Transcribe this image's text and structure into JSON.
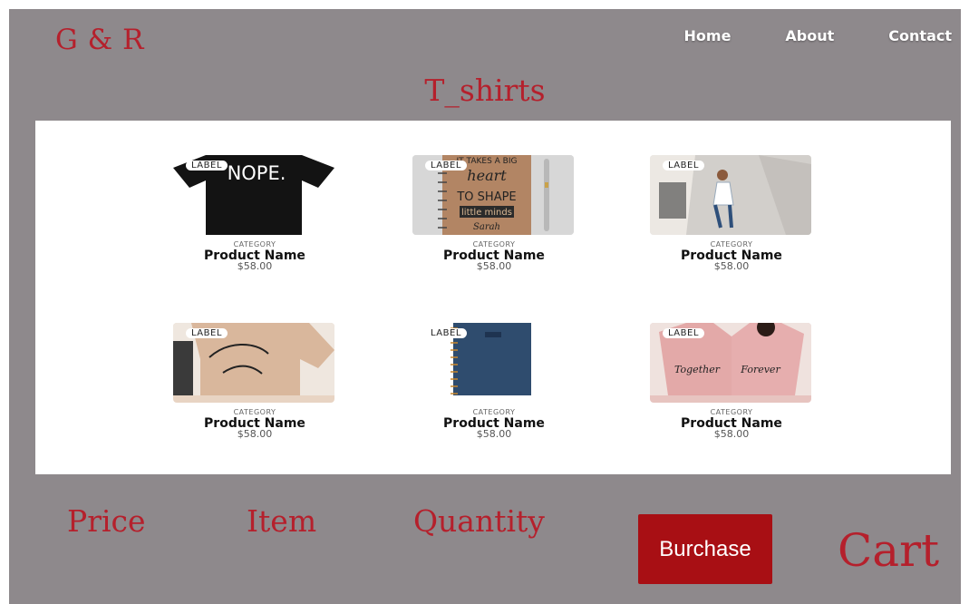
{
  "brand": "G & R",
  "nav": {
    "home": "Home",
    "about": "About",
    "contact": "Contact"
  },
  "page_title": "T_shirts",
  "products": [
    {
      "badge": "LABEL",
      "category": "CATEGORY",
      "name": "Product Name",
      "price": "$58.00",
      "image": "black t-shirt with NOPE. print"
    },
    {
      "badge": "LABEL",
      "category": "CATEGORY",
      "name": "Product Name",
      "price": "$58.00",
      "image": "kraft notebook with pen"
    },
    {
      "badge": "LABEL",
      "category": "CATEGORY",
      "name": "Product Name",
      "price": "$58.00",
      "image": "grey sweater with illustration"
    },
    {
      "badge": "LABEL",
      "category": "CATEGORY",
      "name": "Product Name",
      "price": "$58.00",
      "image": "beige t-shirt with script print"
    },
    {
      "badge": "LABEL",
      "category": "CATEGORY",
      "name": "Product Name",
      "price": "$58.00",
      "image": "navy spiral notebook"
    },
    {
      "badge": "LABEL",
      "category": "CATEGORY",
      "name": "Product Name",
      "price": "$58.00",
      "image": "pink couple t-shirts"
    }
  ],
  "footer": {
    "price_label": "Price",
    "item_label": "Item",
    "quantity_label": "Quantity",
    "purchase_button": "Burchase",
    "cart_label": "Cart"
  },
  "image_text": {
    "nope": "NOPE.",
    "notebook_lines": [
      "IT TAKES A BIG",
      "heart",
      "TO SHAPE",
      "little minds",
      "Sarah"
    ],
    "together": "Together",
    "forever": "Forever"
  },
  "colors": {
    "background": "#8e898c",
    "accent": "#b5202c",
    "button": "#a80f14",
    "panel": "#ffffff"
  }
}
